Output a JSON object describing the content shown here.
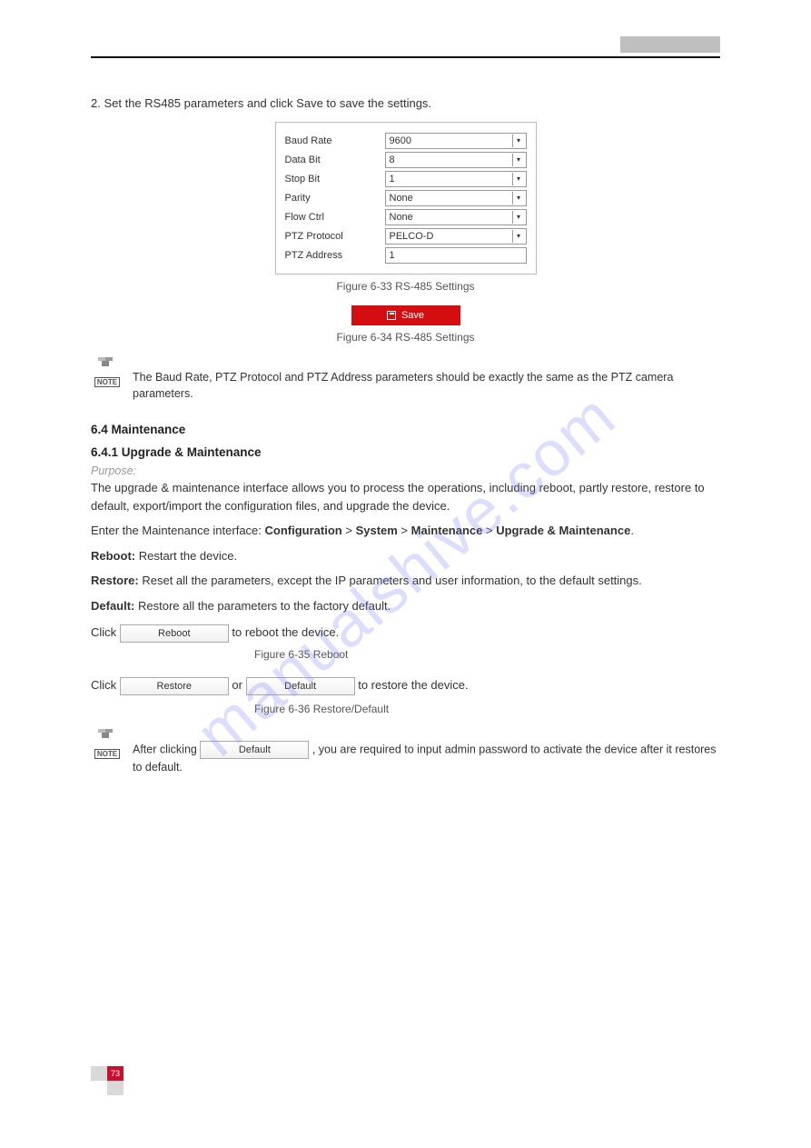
{
  "header": {
    "left": "",
    "right_block": ""
  },
  "intro_text": "2. Set the RS485 parameters and click Save to save the settings.",
  "figure_caption_1": "Figure 6-33 RS-485 Settings",
  "rs485": {
    "rows": [
      {
        "label": "Baud Rate",
        "value": "9600",
        "type": "select"
      },
      {
        "label": "Data Bit",
        "value": "8",
        "type": "select"
      },
      {
        "label": "Stop Bit",
        "value": "1",
        "type": "select"
      },
      {
        "label": "Parity",
        "value": "None",
        "type": "select"
      },
      {
        "label": "Flow Ctrl",
        "value": "None",
        "type": "select"
      },
      {
        "label": "PTZ Protocol",
        "value": "PELCO-D",
        "type": "select"
      },
      {
        "label": "PTZ Address",
        "value": "1",
        "type": "input"
      }
    ]
  },
  "save_button_label": "Save",
  "figure_caption_2": "Figure 6-34 RS-485 Settings",
  "note1": "The Baud Rate, PTZ Protocol and PTZ Address parameters should be exactly the same as the PTZ camera parameters.",
  "maintenance": {
    "heading": "6.4 Maintenance",
    "upgrade_heading": "6.4.1 Upgrade & Maintenance",
    "purpose_label": "Purpose:",
    "purpose_text": "The upgrade & maintenance interface allows you to process the operations, including reboot, partly restore, restore to default, export/import the configuration files, and upgrade the device.",
    "enter_text": "Enter the Maintenance interface: Configuration > System > Maintenance > Upgrade & Maintenance.",
    "reboot_bold": "Reboot:",
    "reboot_text": " Restart the device.",
    "restore_bold": "Restore:",
    "restore_text": " Reset all the parameters, except the IP parameters and user information, to the default settings.",
    "default_bold": "Default:",
    "default_text": " Restore all the parameters to the factory default.",
    "reboot_btn": "Reboot",
    "restore_btn": "Restore",
    "default_btn": "Default",
    "reboot_figcap": "Figure 6-35 Reboot",
    "restore_figcap": "Figure 6-36 Restore/Default",
    "click_line_prefix": "Click ",
    "click_line_suffix": " to reboot the device.",
    "click_restore_prefix": "Click ",
    "click_restore_middle": " or ",
    "click_restore_suffix": " to restore the device."
  },
  "note2_line1": "After clicking ",
  "note2_line2": ", you are required to input admin password to activate the device after it restores to default.",
  "footer_page": "73",
  "watermark": "manualshive.com"
}
